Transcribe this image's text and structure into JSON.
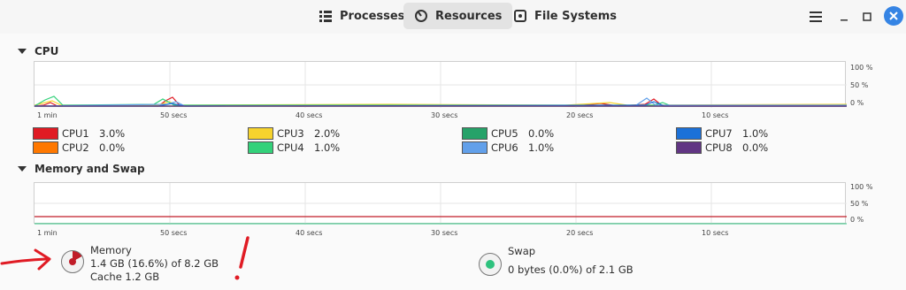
{
  "tabs": [
    {
      "label": "Processes",
      "icon": "list-icon"
    },
    {
      "label": "Resources",
      "icon": "gauge-icon"
    },
    {
      "label": "File Systems",
      "icon": "disk-icon"
    }
  ],
  "window_controls": {
    "menu": "menu-icon",
    "minimize": "minimize-icon",
    "maximize": "maximize-icon",
    "close": "close-icon"
  },
  "cpu": {
    "title": "CPU",
    "y_ticks": [
      "100 %",
      "50 %",
      "0 %"
    ],
    "x_ticks": [
      "1 min",
      "50 secs",
      "40 secs",
      "30 secs",
      "20 secs",
      "10 secs"
    ],
    "cores": [
      {
        "name": "CPU1",
        "value": "3.0%",
        "color": "#e01b24"
      },
      {
        "name": "CPU2",
        "value": "0.0%",
        "color": "#ff7800"
      },
      {
        "name": "CPU3",
        "value": "2.0%",
        "color": "#f6d32d"
      },
      {
        "name": "CPU4",
        "value": "1.0%",
        "color": "#33d17a"
      },
      {
        "name": "CPU5",
        "value": "0.0%",
        "color": "#26a269"
      },
      {
        "name": "CPU6",
        "value": "1.0%",
        "color": "#62a0ea"
      },
      {
        "name": "CPU7",
        "value": "1.0%",
        "color": "#1c71d8"
      },
      {
        "name": "CPU8",
        "value": "0.0%",
        "color": "#613583"
      }
    ]
  },
  "memory": {
    "title": "Memory and Swap",
    "y_ticks": [
      "100 %",
      "50 %",
      "0 %"
    ],
    "x_ticks": [
      "1 min",
      "50 secs",
      "40 secs",
      "30 secs",
      "20 secs",
      "10 secs"
    ],
    "mem_label": "Memory",
    "mem_usage": "1.4 GB (16.6%) of 8.2 GB",
    "mem_cache": "Cache 1.2 GB",
    "mem_percent": 16.6,
    "mem_color": "#c01c28",
    "swap_label": "Swap",
    "swap_usage": "0 bytes (0.0%) of 2.1 GB",
    "swap_color": "#2ec27e"
  }
}
